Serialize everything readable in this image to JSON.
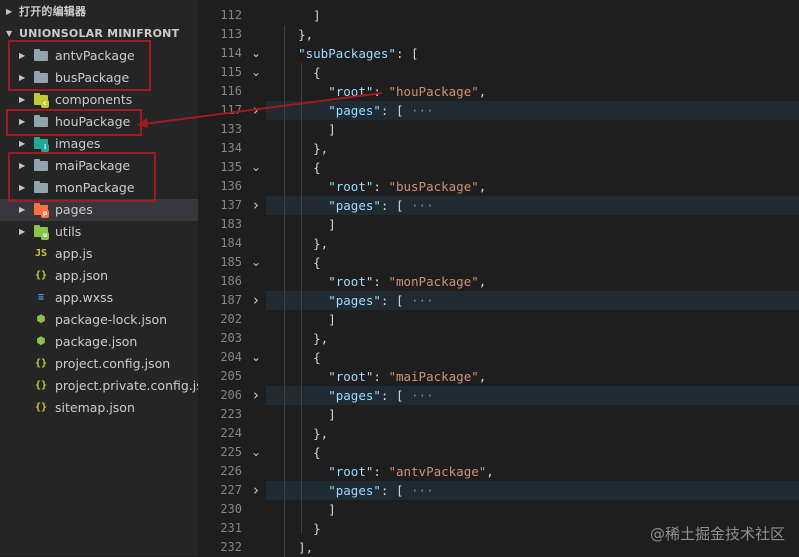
{
  "sidebar": {
    "open_editors_label": "打开的编辑器",
    "project_label": "UNIONSOLAR MINIFRONT",
    "items": [
      {
        "label": "antvPackage",
        "kind": "folder",
        "color": "#90a4ae",
        "badge": ""
      },
      {
        "label": "busPackage",
        "kind": "folder",
        "color": "#90a4ae",
        "badge": ""
      },
      {
        "label": "components",
        "kind": "folder",
        "color": "#c0ca33",
        "badge": "c"
      },
      {
        "label": "houPackage",
        "kind": "folder",
        "color": "#90a4ae",
        "badge": ""
      },
      {
        "label": "images",
        "kind": "folder",
        "color": "#26a69a",
        "badge": "i"
      },
      {
        "label": "maiPackage",
        "kind": "folder",
        "color": "#90a4ae",
        "badge": ""
      },
      {
        "label": "monPackage",
        "kind": "folder",
        "color": "#90a4ae",
        "badge": ""
      },
      {
        "label": "pages",
        "kind": "folder",
        "color": "#ff7043",
        "badge": "p"
      },
      {
        "label": "utils",
        "kind": "folder",
        "color": "#8bc34a",
        "badge": "u"
      },
      {
        "label": "app.js",
        "kind": "file",
        "icon": "JS",
        "color": "#cbcb41"
      },
      {
        "label": "app.json",
        "kind": "file",
        "icon": "{}",
        "color": "#cbcb41"
      },
      {
        "label": "app.wxss",
        "kind": "file",
        "icon": "≡",
        "color": "#42a5f5"
      },
      {
        "label": "package-lock.json",
        "kind": "file",
        "icon": "⬢",
        "color": "#8bc34a"
      },
      {
        "label": "package.json",
        "kind": "file",
        "icon": "⬢",
        "color": "#8bc34a"
      },
      {
        "label": "project.config.json",
        "kind": "file",
        "icon": "{}",
        "color": "#cbcb41"
      },
      {
        "label": "project.private.config.js...",
        "kind": "file",
        "icon": "{}",
        "color": "#cbcb41"
      },
      {
        "label": "sitemap.json",
        "kind": "file",
        "icon": "{}",
        "color": "#cbcb41"
      }
    ]
  },
  "editor": {
    "lines": [
      {
        "n": "112",
        "fold": "",
        "text": [
          {
            "c": "p",
            "t": "      ]"
          }
        ]
      },
      {
        "n": "113",
        "fold": "",
        "text": [
          {
            "c": "p",
            "t": "    },"
          }
        ]
      },
      {
        "n": "114",
        "fold": "v",
        "text": [
          {
            "c": "p",
            "t": "    "
          },
          {
            "c": "k",
            "t": "\"subPackages\""
          },
          {
            "c": "p",
            "t": ": ["
          }
        ]
      },
      {
        "n": "115",
        "fold": "v",
        "text": [
          {
            "c": "p",
            "t": "      {"
          }
        ]
      },
      {
        "n": "116",
        "fold": "",
        "text": [
          {
            "c": "p",
            "t": "        "
          },
          {
            "c": "k",
            "t": "\"root\""
          },
          {
            "c": "p",
            "t": ": "
          },
          {
            "c": "s",
            "t": "\"houPackage\""
          },
          {
            "c": "p",
            "t": ","
          }
        ]
      },
      {
        "n": "117",
        "fold": ">",
        "bg": true,
        "text": [
          {
            "c": "p",
            "t": "        "
          },
          {
            "c": "k",
            "t": "\"pages\""
          },
          {
            "c": "p",
            "t": ": [ "
          },
          {
            "c": "e",
            "t": "···"
          }
        ]
      },
      {
        "n": "133",
        "fold": "",
        "text": [
          {
            "c": "p",
            "t": "        ]"
          }
        ]
      },
      {
        "n": "134",
        "fold": "",
        "text": [
          {
            "c": "p",
            "t": "      },"
          }
        ]
      },
      {
        "n": "135",
        "fold": "v",
        "text": [
          {
            "c": "p",
            "t": "      {"
          }
        ]
      },
      {
        "n": "136",
        "fold": "",
        "text": [
          {
            "c": "p",
            "t": "        "
          },
          {
            "c": "k",
            "t": "\"root\""
          },
          {
            "c": "p",
            "t": ": "
          },
          {
            "c": "s",
            "t": "\"busPackage\""
          },
          {
            "c": "p",
            "t": ","
          }
        ]
      },
      {
        "n": "137",
        "fold": ">",
        "bg": true,
        "text": [
          {
            "c": "p",
            "t": "        "
          },
          {
            "c": "k",
            "t": "\"pages\""
          },
          {
            "c": "p",
            "t": ": [ "
          },
          {
            "c": "e",
            "t": "···"
          }
        ]
      },
      {
        "n": "183",
        "fold": "",
        "text": [
          {
            "c": "p",
            "t": "        ]"
          }
        ]
      },
      {
        "n": "184",
        "fold": "",
        "text": [
          {
            "c": "p",
            "t": "      },"
          }
        ]
      },
      {
        "n": "185",
        "fold": "v",
        "text": [
          {
            "c": "p",
            "t": "      {"
          }
        ]
      },
      {
        "n": "186",
        "fold": "",
        "text": [
          {
            "c": "p",
            "t": "        "
          },
          {
            "c": "k",
            "t": "\"root\""
          },
          {
            "c": "p",
            "t": ": "
          },
          {
            "c": "s",
            "t": "\"monPackage\""
          },
          {
            "c": "p",
            "t": ","
          }
        ]
      },
      {
        "n": "187",
        "fold": ">",
        "bg": true,
        "text": [
          {
            "c": "p",
            "t": "        "
          },
          {
            "c": "k",
            "t": "\"pages\""
          },
          {
            "c": "p",
            "t": ": [ "
          },
          {
            "c": "e",
            "t": "···"
          }
        ]
      },
      {
        "n": "202",
        "fold": "",
        "text": [
          {
            "c": "p",
            "t": "        ]"
          }
        ]
      },
      {
        "n": "203",
        "fold": "",
        "text": [
          {
            "c": "p",
            "t": "      },"
          }
        ]
      },
      {
        "n": "204",
        "fold": "v",
        "text": [
          {
            "c": "p",
            "t": "      {"
          }
        ]
      },
      {
        "n": "205",
        "fold": "",
        "text": [
          {
            "c": "p",
            "t": "        "
          },
          {
            "c": "k",
            "t": "\"root\""
          },
          {
            "c": "p",
            "t": ": "
          },
          {
            "c": "s",
            "t": "\"maiPackage\""
          },
          {
            "c": "p",
            "t": ","
          }
        ]
      },
      {
        "n": "206",
        "fold": ">",
        "bg": true,
        "text": [
          {
            "c": "p",
            "t": "        "
          },
          {
            "c": "k",
            "t": "\"pages\""
          },
          {
            "c": "p",
            "t": ": [ "
          },
          {
            "c": "e",
            "t": "···"
          }
        ]
      },
      {
        "n": "223",
        "fold": "",
        "text": [
          {
            "c": "p",
            "t": "        ]"
          }
        ]
      },
      {
        "n": "224",
        "fold": "",
        "text": [
          {
            "c": "p",
            "t": "      },"
          }
        ]
      },
      {
        "n": "225",
        "fold": "v",
        "text": [
          {
            "c": "p",
            "t": "      {"
          }
        ]
      },
      {
        "n": "226",
        "fold": "",
        "text": [
          {
            "c": "p",
            "t": "        "
          },
          {
            "c": "k",
            "t": "\"root\""
          },
          {
            "c": "p",
            "t": ": "
          },
          {
            "c": "s",
            "t": "\"antvPackage\""
          },
          {
            "c": "p",
            "t": ","
          }
        ]
      },
      {
        "n": "227",
        "fold": ">",
        "bg": true,
        "text": [
          {
            "c": "p",
            "t": "        "
          },
          {
            "c": "k",
            "t": "\"pages\""
          },
          {
            "c": "p",
            "t": ": [ "
          },
          {
            "c": "e",
            "t": "···"
          }
        ]
      },
      {
        "n": "230",
        "fold": "",
        "text": [
          {
            "c": "p",
            "t": "        ]"
          }
        ]
      },
      {
        "n": "231",
        "fold": "",
        "text": [
          {
            "c": "p",
            "t": "      }"
          }
        ]
      },
      {
        "n": "232",
        "fold": "",
        "text": [
          {
            "c": "p",
            "t": "    ],"
          }
        ]
      }
    ]
  },
  "watermark": "@稀土掘金技术社区",
  "annotation_color": "#a11a22"
}
